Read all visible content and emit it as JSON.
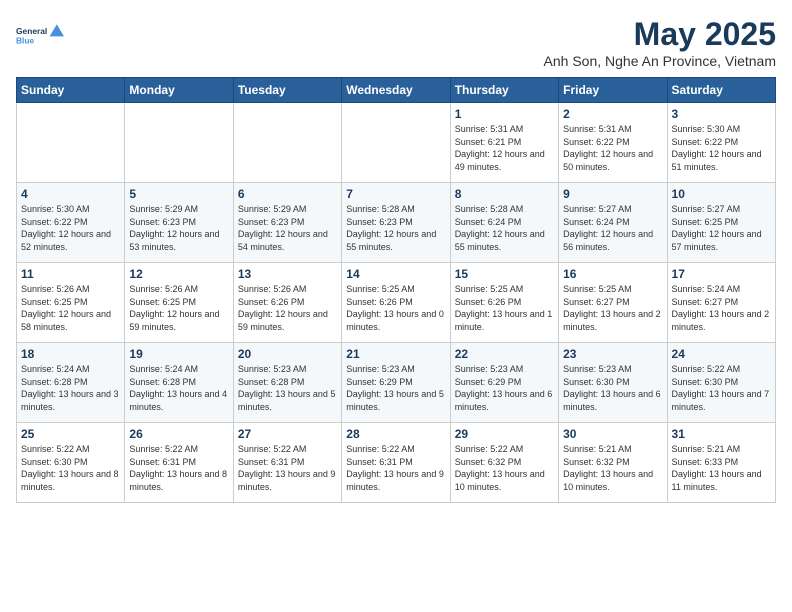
{
  "logo": {
    "line1": "General",
    "line2": "Blue"
  },
  "title": "May 2025",
  "subtitle": "Anh Son, Nghe An Province, Vietnam",
  "weekdays": [
    "Sunday",
    "Monday",
    "Tuesday",
    "Wednesday",
    "Thursday",
    "Friday",
    "Saturday"
  ],
  "weeks": [
    [
      {
        "day": null
      },
      {
        "day": null
      },
      {
        "day": null
      },
      {
        "day": null
      },
      {
        "day": "1",
        "sunrise": "5:31 AM",
        "sunset": "6:21 PM",
        "daylight": "12 hours and 49 minutes."
      },
      {
        "day": "2",
        "sunrise": "5:31 AM",
        "sunset": "6:22 PM",
        "daylight": "12 hours and 50 minutes."
      },
      {
        "day": "3",
        "sunrise": "5:30 AM",
        "sunset": "6:22 PM",
        "daylight": "12 hours and 51 minutes."
      }
    ],
    [
      {
        "day": "4",
        "sunrise": "5:30 AM",
        "sunset": "6:22 PM",
        "daylight": "12 hours and 52 minutes."
      },
      {
        "day": "5",
        "sunrise": "5:29 AM",
        "sunset": "6:23 PM",
        "daylight": "12 hours and 53 minutes."
      },
      {
        "day": "6",
        "sunrise": "5:29 AM",
        "sunset": "6:23 PM",
        "daylight": "12 hours and 54 minutes."
      },
      {
        "day": "7",
        "sunrise": "5:28 AM",
        "sunset": "6:23 PM",
        "daylight": "12 hours and 55 minutes."
      },
      {
        "day": "8",
        "sunrise": "5:28 AM",
        "sunset": "6:24 PM",
        "daylight": "12 hours and 55 minutes."
      },
      {
        "day": "9",
        "sunrise": "5:27 AM",
        "sunset": "6:24 PM",
        "daylight": "12 hours and 56 minutes."
      },
      {
        "day": "10",
        "sunrise": "5:27 AM",
        "sunset": "6:25 PM",
        "daylight": "12 hours and 57 minutes."
      }
    ],
    [
      {
        "day": "11",
        "sunrise": "5:26 AM",
        "sunset": "6:25 PM",
        "daylight": "12 hours and 58 minutes."
      },
      {
        "day": "12",
        "sunrise": "5:26 AM",
        "sunset": "6:25 PM",
        "daylight": "12 hours and 59 minutes."
      },
      {
        "day": "13",
        "sunrise": "5:26 AM",
        "sunset": "6:26 PM",
        "daylight": "12 hours and 59 minutes."
      },
      {
        "day": "14",
        "sunrise": "5:25 AM",
        "sunset": "6:26 PM",
        "daylight": "13 hours and 0 minutes."
      },
      {
        "day": "15",
        "sunrise": "5:25 AM",
        "sunset": "6:26 PM",
        "daylight": "13 hours and 1 minute."
      },
      {
        "day": "16",
        "sunrise": "5:25 AM",
        "sunset": "6:27 PM",
        "daylight": "13 hours and 2 minutes."
      },
      {
        "day": "17",
        "sunrise": "5:24 AM",
        "sunset": "6:27 PM",
        "daylight": "13 hours and 2 minutes."
      }
    ],
    [
      {
        "day": "18",
        "sunrise": "5:24 AM",
        "sunset": "6:28 PM",
        "daylight": "13 hours and 3 minutes."
      },
      {
        "day": "19",
        "sunrise": "5:24 AM",
        "sunset": "6:28 PM",
        "daylight": "13 hours and 4 minutes."
      },
      {
        "day": "20",
        "sunrise": "5:23 AM",
        "sunset": "6:28 PM",
        "daylight": "13 hours and 5 minutes."
      },
      {
        "day": "21",
        "sunrise": "5:23 AM",
        "sunset": "6:29 PM",
        "daylight": "13 hours and 5 minutes."
      },
      {
        "day": "22",
        "sunrise": "5:23 AM",
        "sunset": "6:29 PM",
        "daylight": "13 hours and 6 minutes."
      },
      {
        "day": "23",
        "sunrise": "5:23 AM",
        "sunset": "6:30 PM",
        "daylight": "13 hours and 6 minutes."
      },
      {
        "day": "24",
        "sunrise": "5:22 AM",
        "sunset": "6:30 PM",
        "daylight": "13 hours and 7 minutes."
      }
    ],
    [
      {
        "day": "25",
        "sunrise": "5:22 AM",
        "sunset": "6:30 PM",
        "daylight": "13 hours and 8 minutes."
      },
      {
        "day": "26",
        "sunrise": "5:22 AM",
        "sunset": "6:31 PM",
        "daylight": "13 hours and 8 minutes."
      },
      {
        "day": "27",
        "sunrise": "5:22 AM",
        "sunset": "6:31 PM",
        "daylight": "13 hours and 9 minutes."
      },
      {
        "day": "28",
        "sunrise": "5:22 AM",
        "sunset": "6:31 PM",
        "daylight": "13 hours and 9 minutes."
      },
      {
        "day": "29",
        "sunrise": "5:22 AM",
        "sunset": "6:32 PM",
        "daylight": "13 hours and 10 minutes."
      },
      {
        "day": "30",
        "sunrise": "5:21 AM",
        "sunset": "6:32 PM",
        "daylight": "13 hours and 10 minutes."
      },
      {
        "day": "31",
        "sunrise": "5:21 AM",
        "sunset": "6:33 PM",
        "daylight": "13 hours and 11 minutes."
      }
    ]
  ]
}
